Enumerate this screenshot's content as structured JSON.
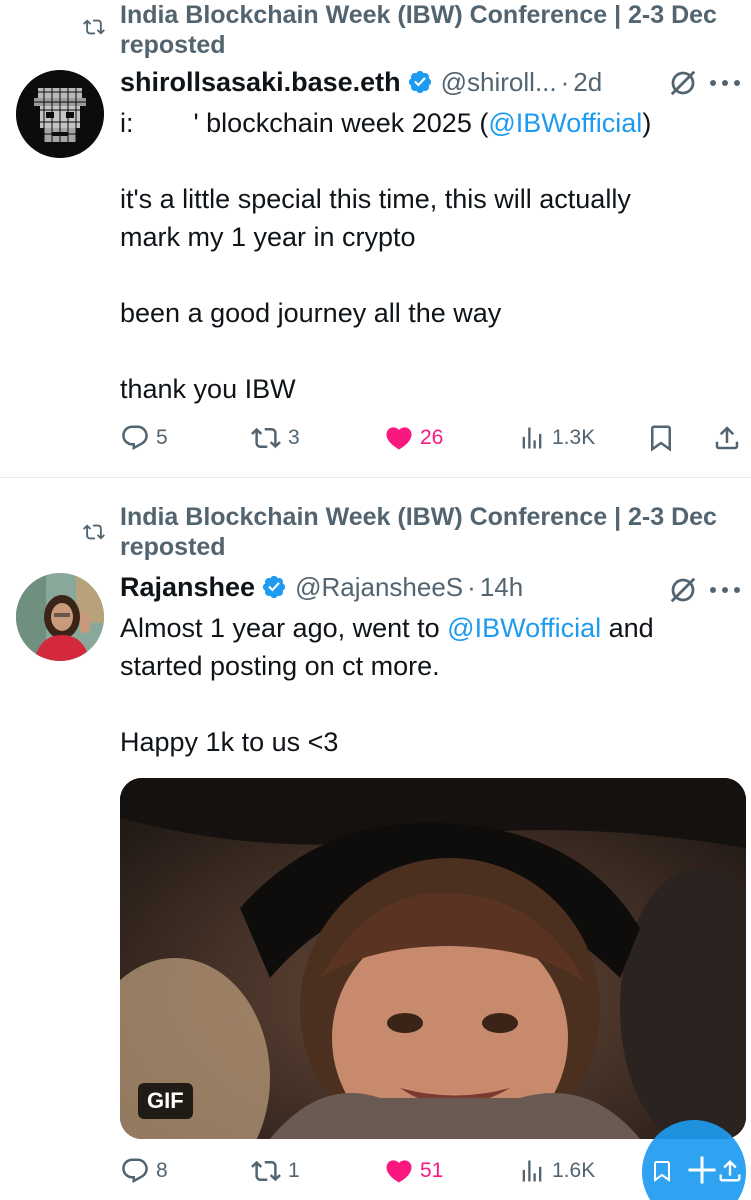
{
  "tweets": [
    {
      "reposted_by": "India Blockchain Week (IBW) Conference | 2-3 Dec reposted",
      "display_name": "shirollsasaki.base.eth",
      "handle": "@shiroll...",
      "time": "2d",
      "text_line1_prefix": "i:        ' blockchain week 2025 (",
      "text_line1_mention": "@IBWofficial",
      "text_line1_suffix": ")",
      "text_rest": "it's a little special this time, this will actually\nmark my 1 year in crypto\n\nbeen a good journey all the way\n\nthank you IBW",
      "replies": "5",
      "reposts": "3",
      "likes": "26",
      "views": "1.3K"
    },
    {
      "reposted_by": "India Blockchain Week (IBW) Conference | 2-3 Dec reposted",
      "display_name": "Rajanshee",
      "handle": "@RajansheeS",
      "time": "14h",
      "text_line1_prefix": "Almost 1 year ago, went to ",
      "text_line1_mention": "@IBWofficial",
      "text_line1_suffix": " and",
      "text_rest": "started posting on ct more.\n\nHappy 1k to us <3",
      "media_badge": "GIF",
      "replies": "8",
      "reposts": "1",
      "likes": "51",
      "views": "1.6K"
    }
  ],
  "colors": {
    "accent": "#1d9bf0",
    "like": "#f91880",
    "secondary_text": "#536471",
    "primary_text": "#0f1419"
  },
  "icons": [
    "repost-icon",
    "verified-badge-icon",
    "grok-icon",
    "more-icon",
    "reply-icon",
    "like-icon",
    "views-icon",
    "bookmark-icon",
    "share-icon",
    "compose-plus-icon"
  ]
}
